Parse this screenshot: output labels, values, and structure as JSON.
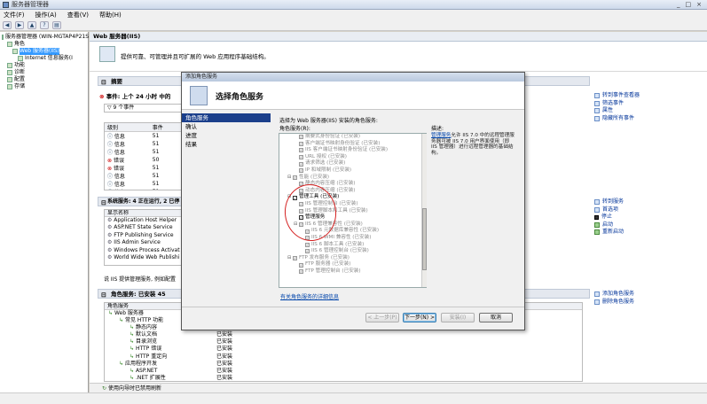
{
  "window": {
    "title": "服务器管理器",
    "controls": [
      "_",
      "□",
      "×"
    ]
  },
  "menu": [
    "文件(F)",
    "操作(A)",
    "查看(V)",
    "帮助(H)"
  ],
  "tree": [
    {
      "label": "服务器管理器 (WIN-MGTAP4P21S",
      "indent": 0
    },
    {
      "label": "角色",
      "indent": 1
    },
    {
      "label": "Web 服务器(IIS)",
      "indent": 2,
      "selected": true
    },
    {
      "label": "Internet 信息服务(I",
      "indent": 3
    },
    {
      "label": "功能",
      "indent": 1
    },
    {
      "label": "诊断",
      "indent": 1
    },
    {
      "label": "配置",
      "indent": 1
    },
    {
      "label": "存储",
      "indent": 1
    }
  ],
  "content": {
    "header": "Web 服务器(IIS)",
    "banner": "提供可靠、可管理并且可扩展的 Web 应用程序基础结构。",
    "summary": {
      "title": "摘要",
      "events_title": "事件: 上个 24 小时 中的",
      "events_count": "9 个事件"
    },
    "events_headers": [
      "级别",
      "事件"
    ],
    "events_rows": [
      [
        "信息",
        "51"
      ],
      [
        "信息",
        "51"
      ],
      [
        "信息",
        "51"
      ],
      [
        "错误",
        "50"
      ],
      [
        "错误",
        "51"
      ],
      [
        "信息",
        "51"
      ],
      [
        "信息",
        "51"
      ],
      [
        "信息",
        "51"
      ],
      [
        "信息",
        "51"
      ]
    ],
    "system_services": {
      "title": "系统服务: 4 正在运行, 2 已停",
      "column": "显示名称",
      "items": [
        "Application Host Helper",
        "ASP.NET State Service",
        "FTP Publishing Service",
        "IIS Admin Service",
        "Windows Process Activat",
        "World Wide Web Publishi"
      ]
    },
    "desc_line": "说 IIS 提供管理服务, 例如配置",
    "role_services": {
      "title": "角色服务: 已安装 45",
      "column": "角色服务"
    },
    "role_rows": [
      {
        "name": "Web 服务器",
        "status": "",
        "indent": 0
      },
      {
        "name": "常见 HTTP 功能",
        "status": "",
        "indent": 1
      },
      {
        "name": "静态内容",
        "status": "已安装",
        "indent": 2
      },
      {
        "name": "默认文档",
        "status": "已安装",
        "indent": 2
      },
      {
        "name": "目录浏览",
        "status": "已安装",
        "indent": 2
      },
      {
        "name": "HTTP 错误",
        "status": "已安装",
        "indent": 2
      },
      {
        "name": "HTTP 重定向",
        "status": "已安装",
        "indent": 2
      },
      {
        "name": "应用程序开发",
        "status": "已安装",
        "indent": 1
      },
      {
        "name": "ASP.NET",
        "status": "已安装",
        "indent": 2
      },
      {
        "name": ".NET 扩展性",
        "status": "已安装",
        "indent": 2
      }
    ],
    "status_bar": "使用向导时已禁用刷新"
  },
  "actions": {
    "summary": [
      "转到事件查看器",
      "筛选事件",
      "属性",
      "隐藏所有事件"
    ],
    "services": [
      "转到服务",
      "首选项",
      "停止",
      "启动",
      "重新启动"
    ],
    "roles": [
      "添加角色服务",
      "删除角色服务"
    ]
  },
  "dialog": {
    "title": "添加角色服务",
    "heading": "选择角色服务",
    "nav": [
      "角色服务",
      "确认",
      "进度",
      "结果"
    ],
    "instruction": "选择为 Web 服务器(IIS) 安装的角色服务:",
    "list_label": "角色服务(R):",
    "services": [
      {
        "label": "摘要式身份验证  (已安装)",
        "indent": 2,
        "checked": true,
        "strong": false
      },
      {
        "label": "客户端证书映射身份验证  (已安装)",
        "indent": 2,
        "checked": true,
        "strong": false
      },
      {
        "label": "IIS 客户端证书映射身份验证  (已安装)",
        "indent": 2,
        "checked": true,
        "strong": false
      },
      {
        "label": "URL 授权  (已安装)",
        "indent": 2,
        "checked": true,
        "strong": false
      },
      {
        "label": "请求筛选  (已安装)",
        "indent": 2,
        "checked": true,
        "strong": false
      },
      {
        "label": "IP 和域限制  (已安装)",
        "indent": 2,
        "checked": true,
        "strong": false
      },
      {
        "label": "性能  (已安装)",
        "indent": 1,
        "checked": true,
        "strong": false,
        "expander": "⊟"
      },
      {
        "label": "静态内容压缩  (已安装)",
        "indent": 2,
        "checked": true,
        "strong": false
      },
      {
        "label": "动态内容压缩  (已安装)",
        "indent": 2,
        "checked": true,
        "strong": false
      },
      {
        "label": "管理工具  (已安装)",
        "indent": 1,
        "checked": true,
        "strong": true,
        "expander": "⊟"
      },
      {
        "label": "IIS 管理控制台  (已安装)",
        "indent": 2,
        "checked": true,
        "strong": false
      },
      {
        "label": "IIS 管理脚本和工具  (已安装)",
        "indent": 2,
        "checked": true,
        "strong": false
      },
      {
        "label": "管理服务",
        "indent": 2,
        "checked": true,
        "strong": true
      },
      {
        "label": "IIS 6 管理兼容性  (已安装)",
        "indent": 2,
        "checked": true,
        "strong": false,
        "expander": "⊟"
      },
      {
        "label": "IIS 6 元数据库兼容性  (已安装)",
        "indent": 3,
        "checked": true,
        "strong": false
      },
      {
        "label": "IIS 6 WMI 兼容性  (已安装)",
        "indent": 3,
        "checked": true,
        "strong": false
      },
      {
        "label": "IIS 6 脚本工具  (已安装)",
        "indent": 3,
        "checked": true,
        "strong": false
      },
      {
        "label": "IIS 6 管理控制台  (已安装)",
        "indent": 3,
        "checked": true,
        "strong": false
      },
      {
        "label": "FTP 发布服务  (已安装)",
        "indent": 1,
        "checked": true,
        "strong": false,
        "expander": "⊟"
      },
      {
        "label": "FTP 服务器  (已安装)",
        "indent": 2,
        "checked": true,
        "strong": false
      },
      {
        "label": "FTP 管理控制台  (已安装)",
        "indent": 2,
        "checked": true,
        "strong": false
      }
    ],
    "description_label": "描述:",
    "description_link": "管理服务",
    "description_text": "允许 IIS 7.0 中的远程管理服务器可被 IIS 7.0 用户界面使用（即 IIS 管理器）进行远程管理器的基础结构。",
    "more_link": "有关角色服务的详细信息",
    "buttons": {
      "prev": "< 上一步(P)",
      "next": "下一步(N) >",
      "install": "安装(I)",
      "cancel": "取消"
    }
  }
}
